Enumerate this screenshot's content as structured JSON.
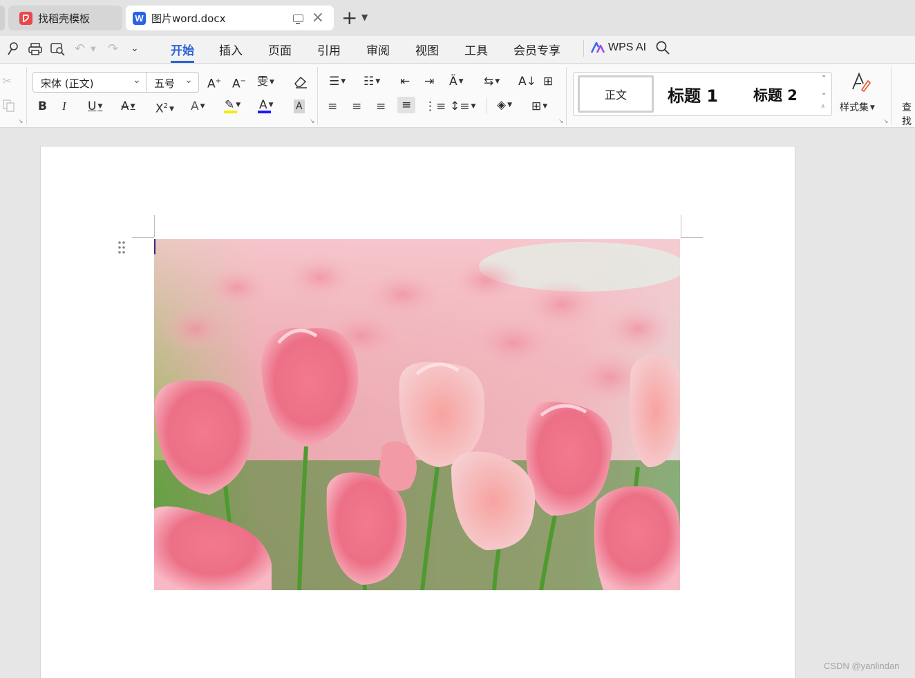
{
  "tabs": [
    {
      "label": "找稻壳模板",
      "icon": "docer-icon",
      "active": false
    },
    {
      "label": "图片word.docx",
      "icon": "word-doc-icon",
      "active": true
    }
  ],
  "menu": {
    "items": [
      "开始",
      "插入",
      "页面",
      "引用",
      "审阅",
      "视图",
      "工具",
      "会员专享"
    ],
    "active": "开始",
    "ai_label": "WPS AI"
  },
  "ribbon": {
    "font_name": "宋体 (正文)",
    "font_size": "五号",
    "styles": {
      "normal": "正文",
      "heading1": "标题 1",
      "heading2": "标题 2"
    },
    "style_set_label": "样式集",
    "find_label": "查找"
  },
  "document": {
    "image": "tulips-photo"
  },
  "watermark": "CSDN @yanlindan",
  "colors": {
    "accent": "#2a62d9",
    "highlight": "#f5e900",
    "font_color": "#1a1aff"
  }
}
